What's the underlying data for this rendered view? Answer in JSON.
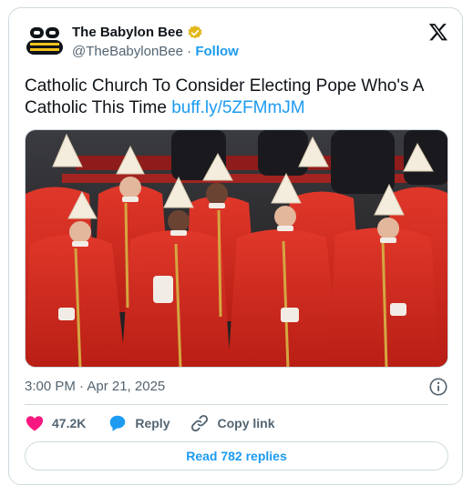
{
  "author": {
    "name": "The Babylon Bee",
    "handle": "@TheBabylonBee",
    "separator": "·",
    "follow_label": "Follow"
  },
  "post": {
    "text": "Catholic Church To Consider Electing Pope Who's A Catholic This Time",
    "link": "buff.ly/5ZFMmJM"
  },
  "meta": {
    "timestamp": "3:00 PM · Apr 21, 2025"
  },
  "actions": {
    "likes": "47.2K",
    "reply_label": "Reply",
    "copy_link_label": "Copy link"
  },
  "replies_button": "Read 782 replies",
  "colors": {
    "accent": "#1d9bf0",
    "like": "#f91880",
    "secondary_text": "#536471",
    "verified_gold": "#e2b719",
    "robe_red": "#d42a1e"
  },
  "icons": [
    "babylon-bee-logo-icon",
    "verified-badge-icon",
    "x-logo-icon",
    "info-icon",
    "heart-icon",
    "reply-bubble-icon",
    "copy-link-icon"
  ]
}
